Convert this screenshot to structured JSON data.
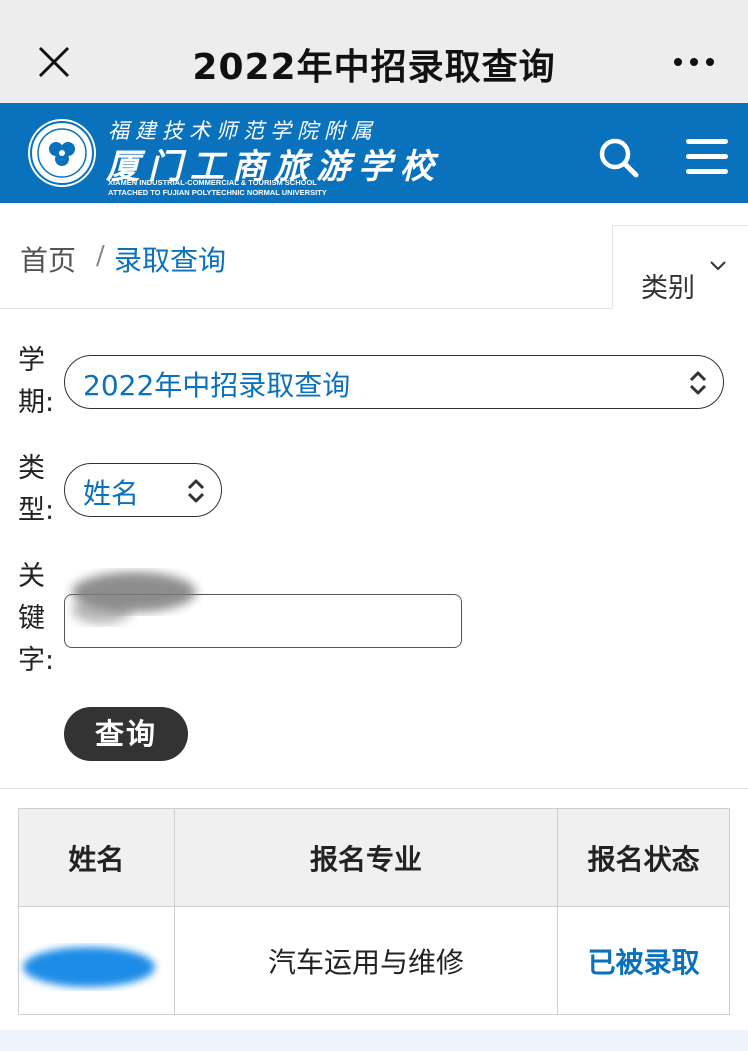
{
  "topbar": {
    "title": "2022年中招录取查询",
    "close_icon": "close-icon",
    "more_icon": "more-icon"
  },
  "header": {
    "school_top": "福建技术师范学院附属",
    "school_name": "厦门工商旅游学校",
    "school_en_1": "XIAMEN INDUSTRIAL-COMMERCIAL & TOURISM SCHOOL",
    "school_en_2": "ATTACHED TO FUJIAN POLYTECHNIC NORMAL UNIVERSITY",
    "brand_color": "#0a71bd"
  },
  "breadcrumb": {
    "home": "首页",
    "separator": "/",
    "current": "录取查询"
  },
  "category": {
    "label": "类别"
  },
  "form": {
    "term_label": "学期:",
    "term_value": "2022年中招录取查询",
    "type_label": "类型:",
    "type_value": "姓名",
    "keyword_label": "关键字:",
    "keyword_value": "",
    "query_button": "查询"
  },
  "table": {
    "headers": [
      "姓名",
      "报名专业",
      "报名状态"
    ],
    "rows": [
      {
        "name": "",
        "major": "汽车运用与维修",
        "status": "已被录取"
      }
    ]
  }
}
